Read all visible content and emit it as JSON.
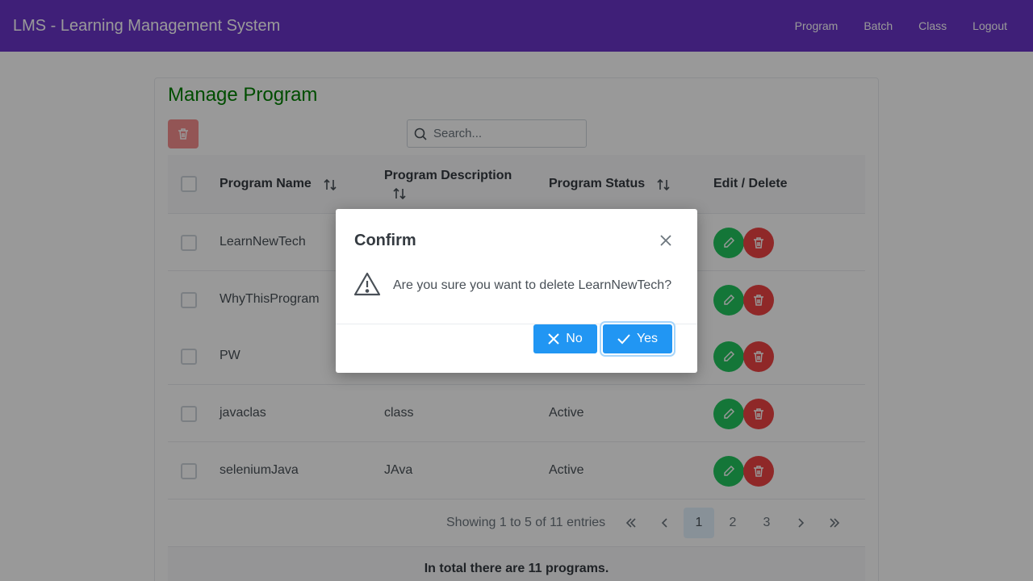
{
  "header": {
    "app_title": "LMS - Learning Management System",
    "nav": [
      "Program",
      "Batch",
      "Class",
      "Logout"
    ]
  },
  "page": {
    "title": "Manage Program",
    "search_placeholder": "Search..."
  },
  "table": {
    "columns": [
      "Program Name",
      "Program Description",
      "Program Status",
      "Edit / Delete"
    ],
    "rows": [
      {
        "name": "LearnNewTech",
        "description": "",
        "status": ""
      },
      {
        "name": "WhyThisProgram",
        "description": "",
        "status": ""
      },
      {
        "name": "PW",
        "description": "",
        "status": ""
      },
      {
        "name": "javaclas",
        "description": "class",
        "status": "Active"
      },
      {
        "name": "seleniumJava",
        "description": "JAva",
        "status": "Active"
      }
    ]
  },
  "pagination": {
    "summary": "Showing 1 to 5 of 11 entries",
    "pages": [
      "1",
      "2",
      "3"
    ],
    "current_page": "1"
  },
  "footer": {
    "text": "In total there are 11 programs."
  },
  "dialog": {
    "title": "Confirm",
    "message": "Are you sure you want to delete LearnNewTech?",
    "no_label": "No",
    "yes_label": "Yes"
  },
  "colors": {
    "header_bg": "#6a35c9",
    "title_green": "#008000",
    "edit_green": "#22c55e",
    "delete_red": "#ef4444",
    "button_blue": "#2196f3"
  },
  "icons": [
    "trash-icon",
    "search-icon",
    "sort-icon",
    "pencil-icon",
    "close-icon",
    "warning-icon",
    "times-icon",
    "check-icon",
    "double-chevron-left-icon",
    "chevron-left-icon",
    "chevron-right-icon",
    "double-chevron-right-icon"
  ]
}
